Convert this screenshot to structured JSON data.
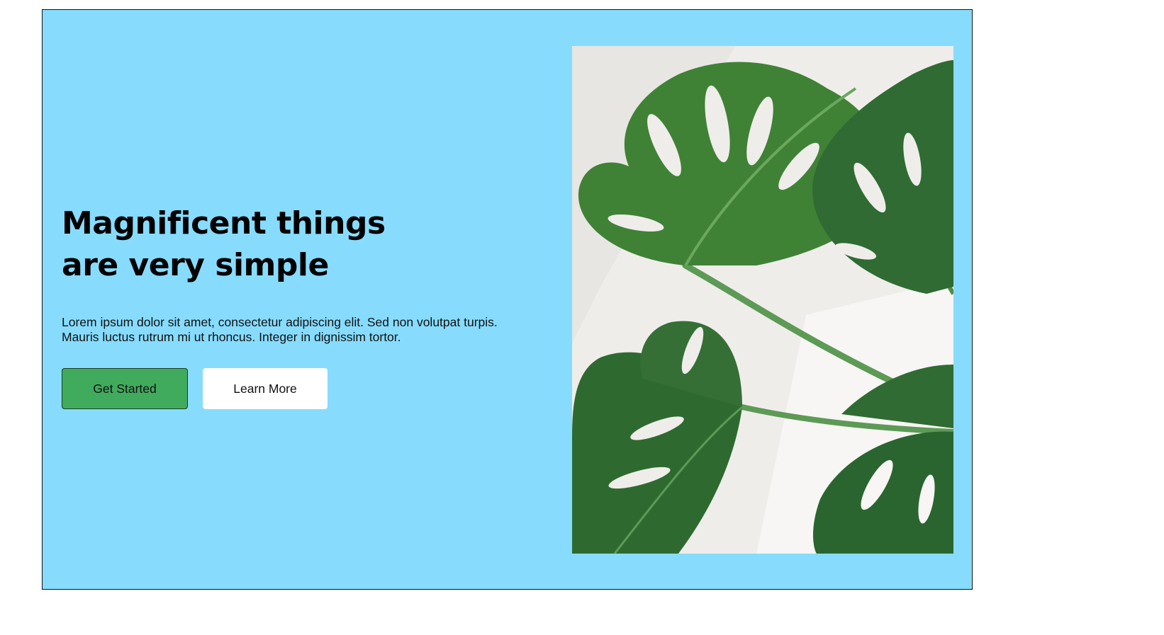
{
  "hero": {
    "title_line1": "Magnificent things",
    "title_line2": "are very simple",
    "text_line1": "Lorem ipsum dolor sit amet, consectetur adipiscing elit. Sed non volutpat turpis.",
    "text_line2": "Mauris luctus rutrum mi ut rhoncus. Integer in dignissim tortor.",
    "primary_button": "Get Started",
    "secondary_button": "Learn More",
    "image": "monstera-leaves-photo"
  },
  "colors": {
    "background": "#87dcfe",
    "primary_button": "#41ab5d",
    "secondary_button": "#ffffff",
    "leaf_dark": "#2f6b32",
    "leaf_light": "#4f9a45"
  }
}
